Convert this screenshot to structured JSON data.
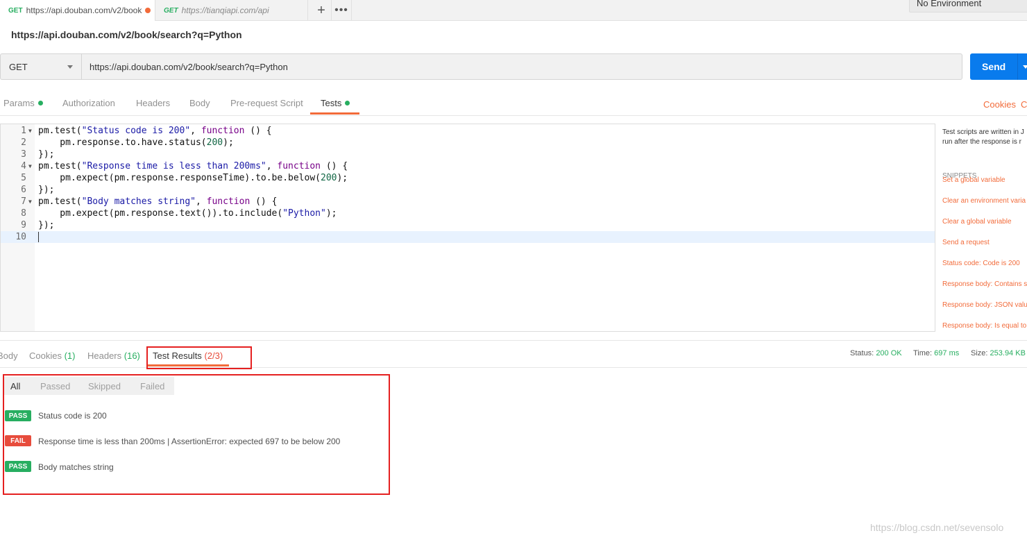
{
  "tabs": [
    {
      "method": "GET",
      "url": "https://api.douban.com/v2/book",
      "unsaved": true
    },
    {
      "method": "GET",
      "url": "https://tianqiapi.com/api"
    }
  ],
  "tab_actions": {
    "new_tab": "+",
    "more": "•••"
  },
  "environment": "No Environment",
  "request": {
    "title": "https://api.douban.com/v2/book/search?q=Python",
    "method": "GET",
    "url": "https://api.douban.com/v2/book/search?q=Python",
    "send_label": "Send"
  },
  "request_tabs": [
    {
      "label": "Params",
      "dot": true
    },
    {
      "label": "Authorization"
    },
    {
      "label": "Headers"
    },
    {
      "label": "Body"
    },
    {
      "label": "Pre-request Script"
    },
    {
      "label": "Tests",
      "dot": true,
      "active": true
    }
  ],
  "links": {
    "cookies": "Cookies",
    "code": "Co"
  },
  "editor": {
    "line_numbers": [
      "1",
      "2",
      "3",
      "4",
      "5",
      "6",
      "7",
      "8",
      "9",
      "10"
    ]
  },
  "snippets": {
    "description_lines": [
      "Test scripts are written in J",
      "run after the response is r"
    ],
    "heading": "SNIPPETS",
    "items": [
      "Set a global variable",
      "Clear an environment varia",
      "Clear a global variable",
      "Send a request",
      "Status code: Code is 200",
      "Response body: Contains s",
      "Response body: JSON valu",
      "Response body: Is equal to"
    ]
  },
  "response_tabs": [
    {
      "label": "Body"
    },
    {
      "label": "Cookies",
      "count": "(1)"
    },
    {
      "label": "Headers",
      "count": "(16)"
    },
    {
      "label": "Test Results",
      "count": "(2/3)",
      "active": true
    }
  ],
  "status": {
    "status_label": "Status:",
    "status_value": "200 OK",
    "time_label": "Time:",
    "time_value": "697 ms",
    "size_label": "Size:",
    "size_value": "253.94 KB"
  },
  "result_filters": [
    {
      "label": "All",
      "active": true
    },
    {
      "label": "Passed"
    },
    {
      "label": "Skipped"
    },
    {
      "label": "Failed"
    }
  ],
  "results": [
    {
      "status": "PASS",
      "text": "Status code is 200"
    },
    {
      "status": "FAIL",
      "text": "Response time is less than 200ms | AssertionError: expected 697 to be below 200"
    },
    {
      "status": "PASS",
      "text": "Body matches string"
    }
  ],
  "watermark": "https://blog.csdn.net/sevensolo",
  "colors": {
    "accent": "#f26b3a",
    "send": "#097bed",
    "pass": "#27ae60",
    "fail": "#e74c3c",
    "highlight_box": "#e52020"
  }
}
